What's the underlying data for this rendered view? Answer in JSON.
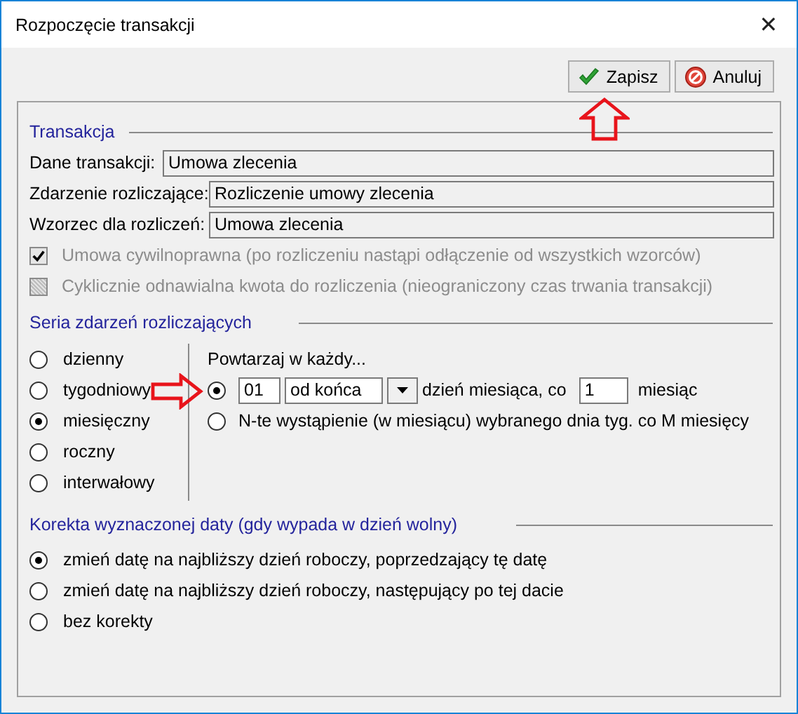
{
  "window": {
    "title": "Rozpoczęcie transakcji",
    "close": "✕"
  },
  "buttons": [
    {
      "kind": "save",
      "label": "Zapisz"
    },
    {
      "kind": "cancel",
      "label": "Anuluj"
    }
  ],
  "transaction": {
    "heading": "Transakcja",
    "fields": [
      {
        "label": "Dane transakcji:",
        "value": "Umowa zlecenia"
      },
      {
        "label": "Zdarzenie rozliczające:",
        "value": "Rozliczenie umowy zlecenia"
      },
      {
        "label": "Wzorzec dla rozliczeń:",
        "value": "Umowa zlecenia"
      }
    ],
    "options": [
      {
        "label": "Umowa cywilnoprawna (po rozliczeniu nastąpi odłączenie od wszystkich wzorców)",
        "checked": true,
        "disabled": true
      },
      {
        "label": "Cyklicznie odnawialna kwota do rozliczenia (nieograniczony czas trwania transakcji)",
        "checked": false,
        "disabled": true
      }
    ]
  },
  "series": {
    "heading": "Seria zdarzeń rozliczających",
    "frequencies": [
      {
        "label": "dzienny",
        "selected": false
      },
      {
        "label": "tygodniowy",
        "selected": false
      },
      {
        "label": "miesięczny",
        "selected": true
      },
      {
        "label": "roczny",
        "selected": false
      },
      {
        "label": "interwałowy",
        "selected": false
      }
    ],
    "repeat_label": "Powtarzaj w każdy...",
    "modes": [
      {
        "kind": "day_of_month",
        "selected": true,
        "day": "01",
        "direction": "od końca",
        "text": "dzień miesiąca, co",
        "interval": "1",
        "unit": "miesiąc"
      },
      {
        "kind": "nth_weekday",
        "selected": false,
        "label": "N-te wystąpienie (w miesiącu) wybranego dnia tyg. co M miesięcy"
      }
    ]
  },
  "correction": {
    "heading": "Korekta wyznaczonej daty (gdy wypada w dzień wolny)",
    "options": [
      {
        "label": "zmień datę na najbliższy dzień roboczy, poprzedzający tę datę",
        "selected": true
      },
      {
        "label": "zmień datę na najbliższy dzień roboczy, następujący po tej dacie",
        "selected": false
      },
      {
        "label": "bez korekty",
        "selected": false
      }
    ]
  },
  "annotations": [
    {
      "kind": "arrow_up"
    },
    {
      "kind": "arrow_right"
    }
  ]
}
